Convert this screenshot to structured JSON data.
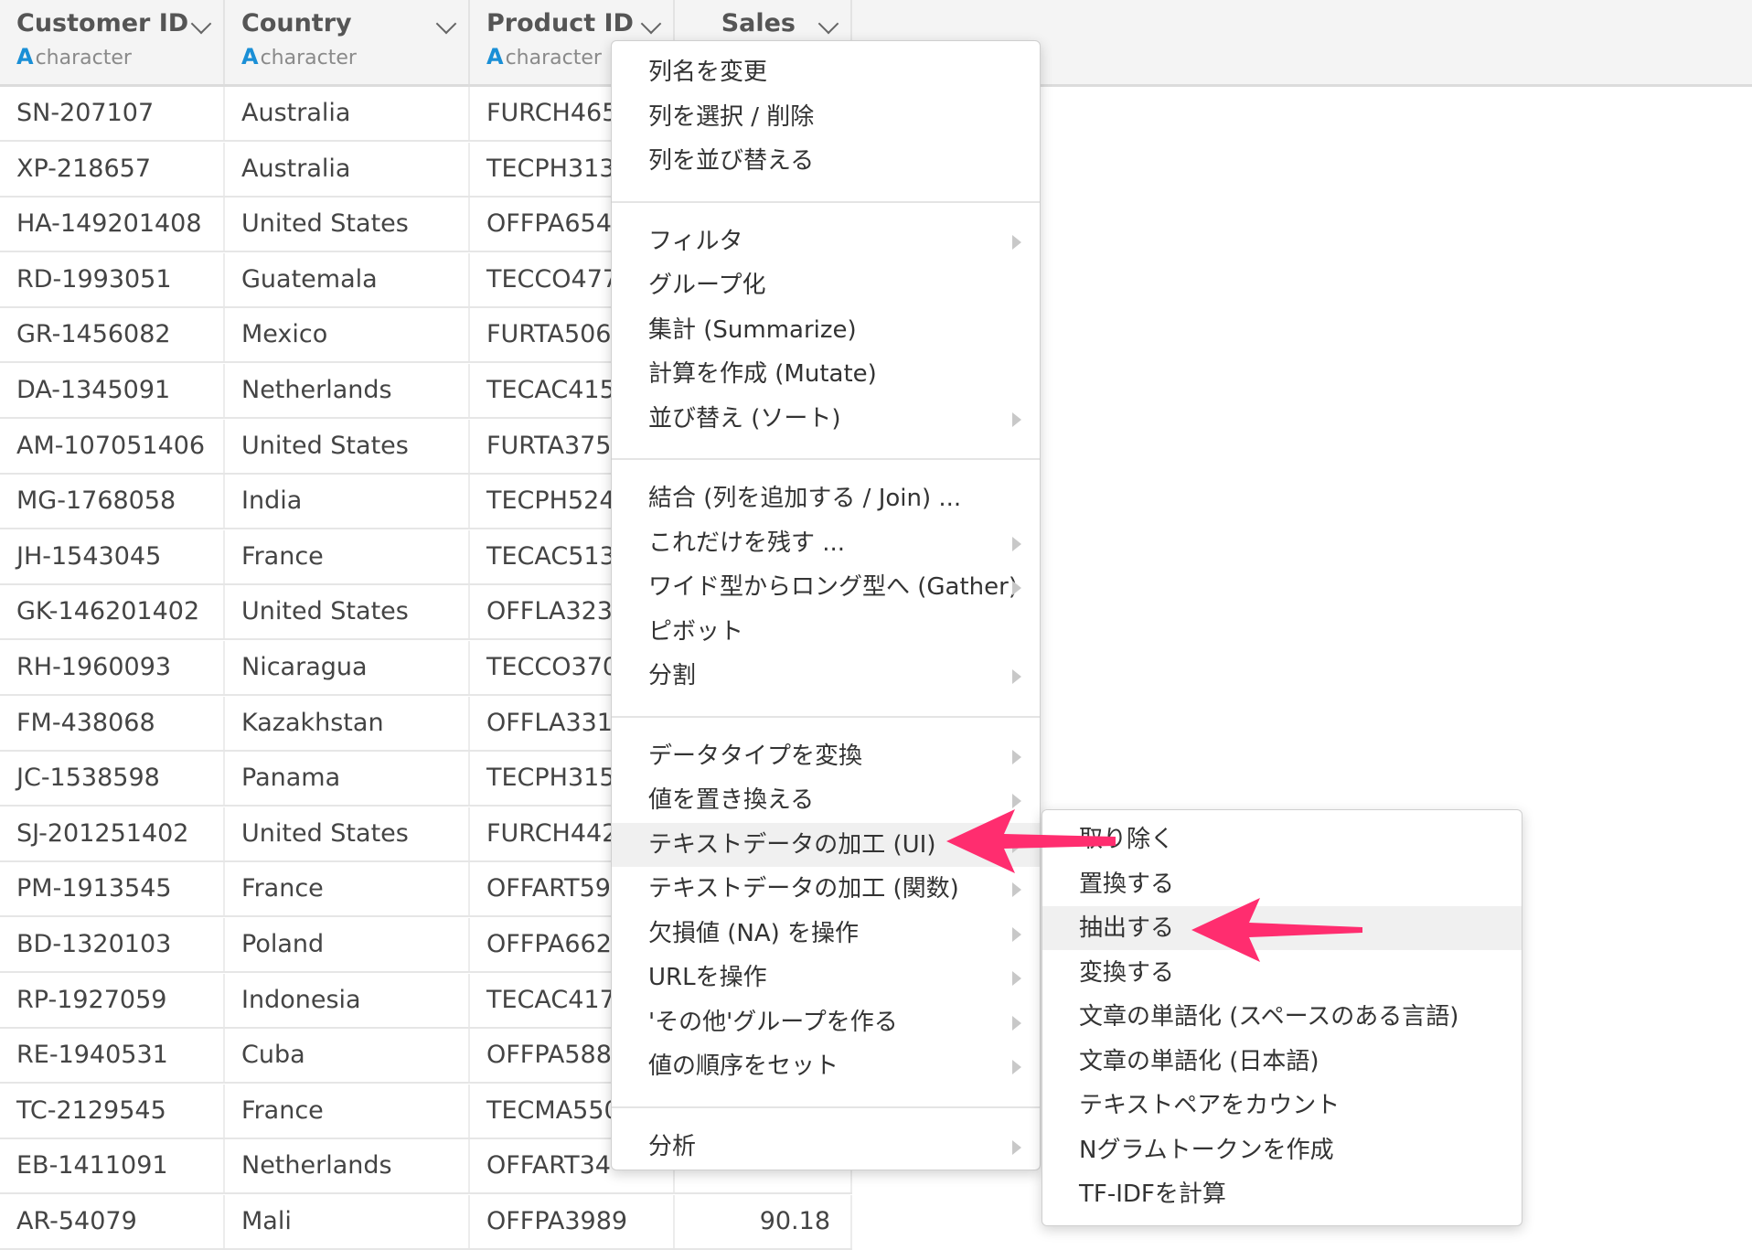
{
  "columns": [
    {
      "name": "Customer ID",
      "type": "character"
    },
    {
      "name": "Country",
      "type": "character"
    },
    {
      "name": "Product ID",
      "type": "character"
    },
    {
      "name": "Sales",
      "type": ""
    }
  ],
  "type_icon": "A",
  "rows": [
    [
      "SN-207107",
      "Australia",
      "FURCH465",
      ""
    ],
    [
      "XP-218657",
      "Australia",
      "TECPH313",
      ""
    ],
    [
      "HA-149201408",
      "United States",
      "OFFPA654",
      ""
    ],
    [
      "RD-1993051",
      "Guatemala",
      "TECCO477",
      ""
    ],
    [
      "GR-1456082",
      "Mexico",
      "FURTA506",
      ""
    ],
    [
      "DA-1345091",
      "Netherlands",
      "TECAC415",
      ""
    ],
    [
      "AM-107051406",
      "United States",
      "FURTA375",
      ""
    ],
    [
      "MG-1768058",
      "India",
      "TECPH524",
      ""
    ],
    [
      "JH-1543045",
      "France",
      "TECAC513",
      ""
    ],
    [
      "GK-146201402",
      "United States",
      "OFFLA323",
      ""
    ],
    [
      "RH-1960093",
      "Nicaragua",
      "TECCO370",
      ""
    ],
    [
      "FM-438068",
      "Kazakhstan",
      "OFFLA331",
      ""
    ],
    [
      "JC-1538598",
      "Panama",
      "TECPH315",
      ""
    ],
    [
      "SJ-201251402",
      "United States",
      "FURCH442",
      ""
    ],
    [
      "PM-1913545",
      "France",
      "OFFART59",
      ""
    ],
    [
      "BD-1320103",
      "Poland",
      "OFFPA662",
      ""
    ],
    [
      "RP-1927059",
      "Indonesia",
      "TECAC417",
      ""
    ],
    [
      "RE-1940531",
      "Cuba",
      "OFFPA588",
      ""
    ],
    [
      "TC-2129545",
      "France",
      "TECMA550",
      ""
    ],
    [
      "EB-1411091",
      "Netherlands",
      "OFFART34",
      ""
    ],
    [
      "AR-54079",
      "Mali",
      "OFFPA3989",
      "90.18"
    ]
  ],
  "menu_groups": [
    [
      {
        "label": "列名を変更",
        "sub": false
      },
      {
        "label": "列を選択 / 削除",
        "sub": false
      },
      {
        "label": "列を並び替える",
        "sub": false
      }
    ],
    [
      {
        "label": "フィルタ",
        "sub": true
      },
      {
        "label": "グループ化",
        "sub": false
      },
      {
        "label": "集計 (Summarize)",
        "sub": false
      },
      {
        "label": "計算を作成 (Mutate)",
        "sub": false
      },
      {
        "label": "並び替え (ソート)",
        "sub": true
      }
    ],
    [
      {
        "label": "結合 (列を追加する / Join) ...",
        "sub": false
      },
      {
        "label": "これだけを残す ...",
        "sub": true
      },
      {
        "label": "ワイド型からロング型へ (Gather)",
        "sub": true
      },
      {
        "label": "ピボット",
        "sub": false
      },
      {
        "label": "分割",
        "sub": true
      }
    ],
    [
      {
        "label": "データタイプを変換",
        "sub": true
      },
      {
        "label": "値を置き換える",
        "sub": true
      },
      {
        "label": "テキストデータの加工 (UI)",
        "sub": true
      },
      {
        "label": "テキストデータの加工 (関数)",
        "sub": true
      },
      {
        "label": "欠損値 (NA) を操作",
        "sub": true
      },
      {
        "label": "URLを操作",
        "sub": true
      },
      {
        "label": "'その他'グループを作る",
        "sub": true
      },
      {
        "label": "値の順序をセット",
        "sub": true
      }
    ],
    [
      {
        "label": "分析",
        "sub": true
      }
    ]
  ],
  "submenu": [
    "取り除く",
    "置換する",
    "抽出する",
    "変換する",
    "文章の単語化 (スペースのある言語)",
    "文章の単語化 (日本語)",
    "テキストペアをカウント",
    "Nグラムトークンを作成",
    "TF-IDFを計算"
  ],
  "colors": {
    "accent_arrow": "#ff2d6f",
    "type_icon": "#1a8fd6"
  }
}
